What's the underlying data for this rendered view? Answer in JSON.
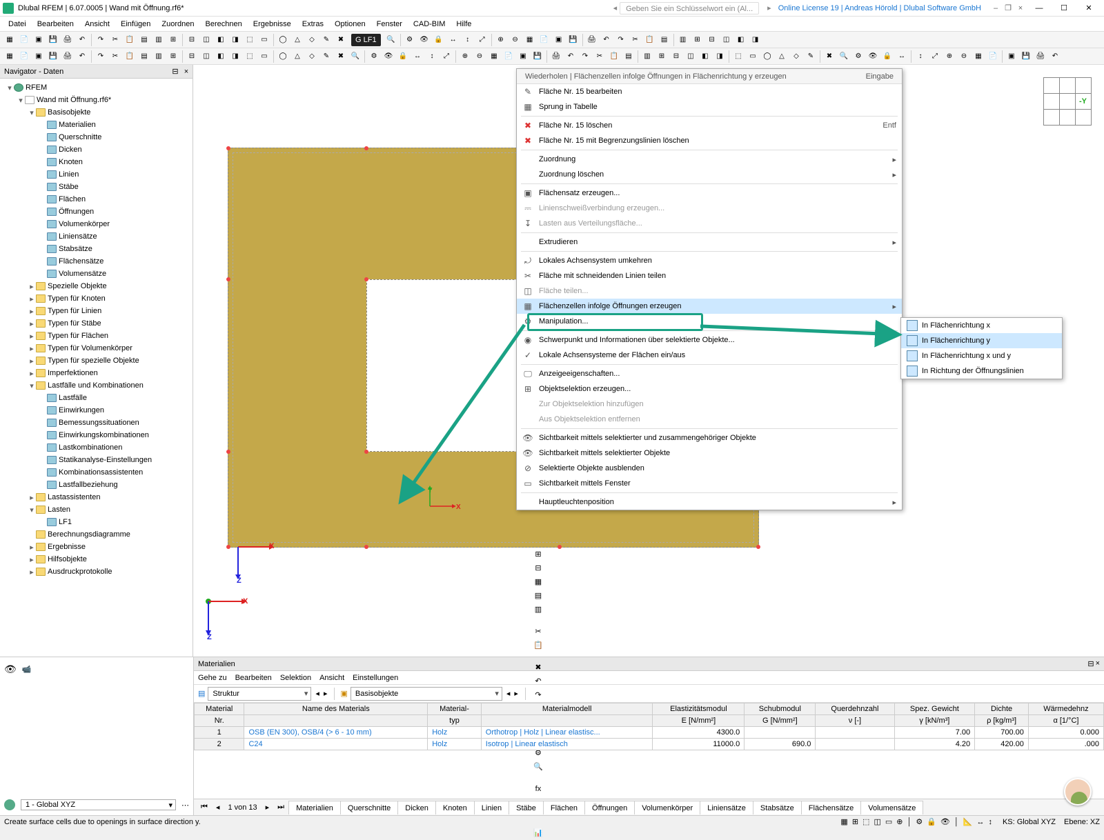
{
  "titlebar": {
    "app": "Dlubal RFEM | 6.07.0005",
    "file": "Wand mit Öffnung.rf6*",
    "search_hint": "Geben Sie ein Schlüsselwort ein (Al...",
    "license": "Online License 19 | Andreas Hörold | Dlubal Software GmbH"
  },
  "menus": [
    "Datei",
    "Bearbeiten",
    "Ansicht",
    "Einfügen",
    "Zuordnen",
    "Berechnen",
    "Ergebnisse",
    "Extras",
    "Optionen",
    "Fenster",
    "CAD-BIM",
    "Hilfe"
  ],
  "lf_badge": "LF1",
  "navigator": {
    "title": "Navigator - Daten",
    "root": "RFEM",
    "file": "Wand mit Öffnung.rf6*",
    "groups": [
      {
        "label": "Basisobjekte",
        "children": [
          "Materialien",
          "Querschnitte",
          "Dicken",
          "Knoten",
          "Linien",
          "Stäbe",
          "Flächen",
          "Öffnungen",
          "Volumenkörper",
          "Liniensätze",
          "Stabsätze",
          "Flächensätze",
          "Volumensätze"
        ]
      },
      {
        "label": "Spezielle Objekte"
      },
      {
        "label": "Typen für Knoten"
      },
      {
        "label": "Typen für Linien"
      },
      {
        "label": "Typen für Stäbe"
      },
      {
        "label": "Typen für Flächen"
      },
      {
        "label": "Typen für Volumenkörper"
      },
      {
        "label": "Typen für spezielle Objekte"
      },
      {
        "label": "Imperfektionen"
      },
      {
        "label": "Lastfälle und Kombinationen",
        "children": [
          "Lastfälle",
          "Einwirkungen",
          "Bemessungssituationen",
          "Einwirkungskombinationen",
          "Lastkombinationen",
          "Statikanalyse-Einstellungen",
          "Kombinationsassistenten",
          "Lastfallbeziehung"
        ]
      },
      {
        "label": "Lastassistenten"
      },
      {
        "label": "Lasten",
        "children": [
          "LF1"
        ]
      },
      {
        "label": "Berechnungsdiagramme",
        "leaf": true
      },
      {
        "label": "Ergebnisse"
      },
      {
        "label": "Hilfsobjekte"
      },
      {
        "label": "Ausdruckprotokolle"
      }
    ]
  },
  "compass_label": "-Y",
  "axes": {
    "x": "X",
    "y": "Y",
    "z": "Z"
  },
  "context_menu": {
    "title_left": "Wiederholen | Flächenzellen infolge Öffnungen in Flächenrichtung y erzeugen",
    "title_right": "Eingabe",
    "items": [
      {
        "t": "Fläche Nr. 15 bearbeiten",
        "ico": "✎"
      },
      {
        "t": "Sprung in Tabelle",
        "ico": "▦"
      },
      {
        "sep": true
      },
      {
        "t": "Fläche Nr. 15 löschen",
        "ico": "✖",
        "short": "Entf",
        "red": true
      },
      {
        "t": "Fläche Nr. 15 mit Begrenzungslinien löschen",
        "ico": "✖",
        "red": true
      },
      {
        "sep": true
      },
      {
        "t": "Zuordnung",
        "arrow": true
      },
      {
        "t": "Zuordnung löschen",
        "arrow": true
      },
      {
        "sep": true
      },
      {
        "t": "Flächensatz erzeugen...",
        "ico": "▣"
      },
      {
        "t": "Linienschweißverbindung erzeugen...",
        "ico": "⎓",
        "disabled": true
      },
      {
        "t": "Lasten aus Verteilungsfläche...",
        "ico": "↧",
        "disabled": true
      },
      {
        "sep": true
      },
      {
        "t": "Extrudieren",
        "arrow": true
      },
      {
        "sep": true
      },
      {
        "t": "Lokales Achsensystem umkehren",
        "ico": "⤾"
      },
      {
        "t": "Fläche mit schneidenden Linien teilen",
        "ico": "✂"
      },
      {
        "t": "Fläche teilen...",
        "ico": "◫",
        "disabled": true
      },
      {
        "t": "Flächenzellen infolge Öffnungen erzeugen",
        "ico": "▦",
        "hl": true,
        "arrow": true
      },
      {
        "t": "Manipulation...",
        "ico": "⚙"
      },
      {
        "sep": true
      },
      {
        "t": "Schwerpunkt und Informationen über selektierte Objekte...",
        "ico": "◉"
      },
      {
        "t": "Lokale Achsensysteme der Flächen ein/aus",
        "ico": "✓"
      },
      {
        "sep": true
      },
      {
        "t": "Anzeigeeigenschaften...",
        "ico": "🖵"
      },
      {
        "t": "Objektselektion erzeugen...",
        "ico": "⊞"
      },
      {
        "t": "Zur Objektselektion hinzufügen",
        "disabled": true
      },
      {
        "t": "Aus Objektselektion entfernen",
        "disabled": true
      },
      {
        "sep": true
      },
      {
        "t": "Sichtbarkeit mittels selektierter und zusammengehöriger Objekte",
        "ico": "👁"
      },
      {
        "t": "Sichtbarkeit mittels selektierter Objekte",
        "ico": "👁"
      },
      {
        "t": "Selektierte Objekte ausblenden",
        "ico": "⊘"
      },
      {
        "t": "Sichtbarkeit mittels Fenster",
        "ico": "▭"
      },
      {
        "sep": true
      },
      {
        "t": "Hauptleuchtenposition",
        "arrow": true
      }
    ]
  },
  "submenu_items": [
    {
      "t": "In Flächenrichtung x"
    },
    {
      "t": "In Flächenrichtung y",
      "hl": true
    },
    {
      "t": "In Flächenrichtung x und y"
    },
    {
      "t": "In Richtung der Öffnungslinien"
    }
  ],
  "bottom": {
    "title": "Materialien",
    "menus": [
      "Gehe zu",
      "Bearbeiten",
      "Selektion",
      "Ansicht",
      "Einstellungen"
    ],
    "combo1": "Struktur",
    "combo2": "Basisobjekte",
    "headers_row1": [
      "Material",
      "Name des Materials",
      "Material-",
      "Materialmodell",
      "Elastizitätsmodul",
      "Schubmodul",
      "Querdehnzahl",
      "Spez. Gewicht",
      "Dichte",
      "Wärmedehnz"
    ],
    "headers_row2": [
      "Nr.",
      "",
      "typ",
      "",
      "E [N/mm²]",
      "G [N/mm²]",
      "ν [-]",
      "γ [kN/m³]",
      "ρ [kg/m³]",
      "α [1/°C]"
    ],
    "rows": [
      {
        "nr": "1",
        "name": "OSB (EN 300), OSB/4 (> 6 - 10 mm)",
        "typ": "Holz",
        "model": "Orthotrop | Holz | Linear elastisc...",
        "E": "4300.0",
        "G": "",
        "nu": "",
        "gamma": "7.00",
        "rho": "700.00",
        "alpha": "0.000",
        "sel": true
      },
      {
        "nr": "2",
        "name": "C24",
        "typ": "Holz",
        "model": "Isotrop | Linear elastisch",
        "E": "11000.0",
        "G": "690.0",
        "nu": "",
        "gamma": "4.20",
        "rho": "420.00",
        "alpha": ".000"
      }
    ],
    "page_info": "1 von 13",
    "tabs": [
      "Materialien",
      "Querschnitte",
      "Dicken",
      "Knoten",
      "Linien",
      "Stäbe",
      "Flächen",
      "Öffnungen",
      "Volumenkörper",
      "Liniensätze",
      "Stabsätze",
      "Flächensätze",
      "Volumensätze"
    ]
  },
  "left_bottom": {
    "combo": "1 - Global XYZ"
  },
  "status": {
    "msg": "Create surface cells due to openings in surface direction y.",
    "ks": "KS: Global XYZ",
    "ebene": "Ebene: XZ"
  }
}
